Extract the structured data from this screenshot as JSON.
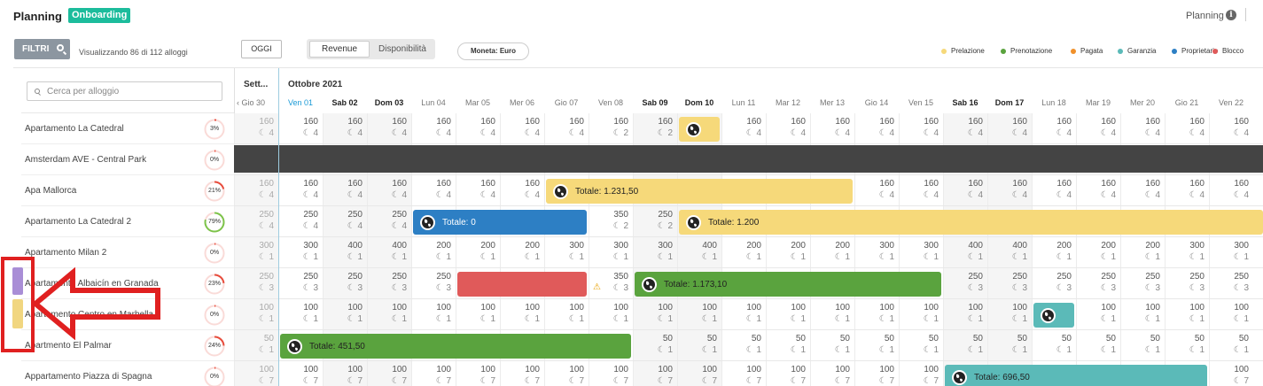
{
  "topbar": {
    "title": "Planning",
    "badge": "Onboarding",
    "right_label": "Planning",
    "info_icon": "info-icon"
  },
  "toolbar": {
    "filter_label": "FILTRI",
    "visualizing_text": "Visualizzando 86 di 112 alloggi",
    "today_label": "OGGI",
    "segments": {
      "revenue": "Revenue",
      "availability": "Disponibilità",
      "active": "Revenue"
    },
    "currency_label": "Moneta: Euro"
  },
  "legend": [
    {
      "label": "Prelazione",
      "color": "#f6d97a"
    },
    {
      "label": "Prenotazione",
      "color": "#5aa33e"
    },
    {
      "label": "Pagata",
      "color": "#f0902a"
    },
    {
      "label": "Garanzia",
      "color": "#5bbab8"
    },
    {
      "label": "Proprietario",
      "color": "#2d7fc4"
    },
    {
      "label": "Blocco",
      "color": "#e05a5a"
    }
  ],
  "search": {
    "placeholder": "Cerca per alloggio"
  },
  "calendar": {
    "week_label": "Sett...",
    "month_label": "Ottobre 2021",
    "prev_day": "Gio 30",
    "days": [
      {
        "label": "Ven 01",
        "weekend": false,
        "today": true
      },
      {
        "label": "Sab 02",
        "weekend": true,
        "today": false
      },
      {
        "label": "Dom 03",
        "weekend": true,
        "today": false
      },
      {
        "label": "Lun 04",
        "weekend": false,
        "today": false
      },
      {
        "label": "Mar 05",
        "weekend": false,
        "today": false
      },
      {
        "label": "Mer 06",
        "weekend": false,
        "today": false
      },
      {
        "label": "Gio 07",
        "weekend": false,
        "today": false
      },
      {
        "label": "Ven 08",
        "weekend": false,
        "today": false
      },
      {
        "label": "Sab 09",
        "weekend": true,
        "today": false
      },
      {
        "label": "Dom 10",
        "weekend": true,
        "today": false
      },
      {
        "label": "Lun 11",
        "weekend": false,
        "today": false
      },
      {
        "label": "Mar 12",
        "weekend": false,
        "today": false
      },
      {
        "label": "Mer 13",
        "weekend": false,
        "today": false
      },
      {
        "label": "Gio 14",
        "weekend": false,
        "today": false
      },
      {
        "label": "Ven 15",
        "weekend": false,
        "today": false
      },
      {
        "label": "Sab 16",
        "weekend": true,
        "today": false
      },
      {
        "label": "Dom 17",
        "weekend": true,
        "today": false
      },
      {
        "label": "Lun 18",
        "weekend": false,
        "today": false
      },
      {
        "label": "Mar 19",
        "weekend": false,
        "today": false
      },
      {
        "label": "Mer 20",
        "weekend": false,
        "today": false
      },
      {
        "label": "Gio 21",
        "weekend": false,
        "today": false
      },
      {
        "label": "Ven 22",
        "weekend": false,
        "today": false
      }
    ]
  },
  "properties": [
    {
      "name": "Apartamento La Catedral",
      "occupancy": "3%",
      "occ_value": 3,
      "ring_color": "#e74c3c",
      "cells": [
        [
          "160",
          "4"
        ],
        [
          "160",
          "4"
        ],
        [
          "160",
          "4"
        ],
        [
          "160",
          "4"
        ],
        [
          "160",
          "4"
        ],
        [
          "160",
          "4"
        ],
        [
          "160",
          "4"
        ],
        [
          "160",
          "4"
        ],
        [
          "160",
          "2"
        ],
        [
          "160",
          "2"
        ],
        null,
        [
          "160",
          "4"
        ],
        [
          "160",
          "4"
        ],
        [
          "160",
          "4"
        ],
        [
          "160",
          "4"
        ],
        [
          "160",
          "4"
        ],
        [
          "160",
          "4"
        ],
        [
          "160",
          "4"
        ],
        [
          "160",
          "4"
        ],
        [
          "160",
          "4"
        ],
        [
          "160",
          "4"
        ],
        [
          "160",
          "4"
        ],
        [
          "160",
          "4"
        ]
      ],
      "bookings": [
        {
          "start": 10,
          "span": 1,
          "label": "",
          "status": "Prelazione"
        }
      ]
    },
    {
      "name": "Amsterdam AVE - Central Park",
      "occupancy": "0%",
      "occ_value": 0,
      "ring_color": "#e74c3c",
      "blocked": true,
      "cells": [],
      "bookings": []
    },
    {
      "name": "Apa Mallorca",
      "occupancy": "21%",
      "occ_value": 21,
      "ring_color": "#e74c3c",
      "cells": [
        [
          "160",
          "4"
        ],
        [
          "160",
          "4"
        ],
        [
          "160",
          "4"
        ],
        [
          "160",
          "4"
        ],
        [
          "160",
          "4"
        ],
        [
          "160",
          "4"
        ],
        [
          "160",
          "4"
        ],
        null,
        null,
        null,
        null,
        null,
        null,
        null,
        [
          "160",
          "4"
        ],
        [
          "160",
          "4"
        ],
        [
          "160",
          "4"
        ],
        [
          "160",
          "4"
        ],
        [
          "160",
          "4"
        ],
        [
          "160",
          "4"
        ],
        [
          "160",
          "4"
        ],
        [
          "160",
          "4"
        ],
        [
          "160",
          "4"
        ]
      ],
      "bookings": [
        {
          "start": 7,
          "span": 7,
          "label": "Totale: 1.231,50",
          "status": "Prelazione"
        }
      ]
    },
    {
      "name": "Apartamento La Catedral 2",
      "occupancy": "79%",
      "occ_value": 79,
      "ring_color": "#7cc44a",
      "cells": [
        [
          "250",
          "4"
        ],
        [
          "250",
          "4"
        ],
        [
          "250",
          "4"
        ],
        [
          "250",
          "4"
        ],
        null,
        null,
        null,
        null,
        [
          "350",
          "2"
        ],
        [
          "250",
          "2"
        ],
        null,
        null,
        null,
        null,
        null,
        null,
        null,
        null,
        null,
        null,
        null,
        null,
        null
      ],
      "bookings": [
        {
          "start": 4,
          "span": 4,
          "label": "Totale: 0",
          "status": "Proprietario"
        },
        {
          "start": 10,
          "span": 14,
          "label": "Totale: 1.200",
          "status": "Prelazione"
        }
      ]
    },
    {
      "name": "Apartamento Milan 2",
      "occupancy": "0%",
      "occ_value": 0,
      "ring_color": "#e74c3c",
      "cells": [
        [
          "300",
          "1"
        ],
        [
          "300",
          "1"
        ],
        [
          "400",
          "1"
        ],
        [
          "400",
          "1"
        ],
        [
          "200",
          "1"
        ],
        [
          "200",
          "1"
        ],
        [
          "200",
          "1"
        ],
        [
          "300",
          "1"
        ],
        [
          "300",
          "1"
        ],
        [
          "300",
          "1"
        ],
        [
          "400",
          "1"
        ],
        [
          "200",
          "1"
        ],
        [
          "200",
          "1"
        ],
        [
          "200",
          "1"
        ],
        [
          "300",
          "1"
        ],
        [
          "300",
          "1"
        ],
        [
          "400",
          "1"
        ],
        [
          "400",
          "1"
        ],
        [
          "200",
          "1"
        ],
        [
          "200",
          "1"
        ],
        [
          "200",
          "1"
        ],
        [
          "300",
          "1"
        ],
        [
          "300",
          "1"
        ]
      ],
      "bookings": []
    },
    {
      "name": "Apartamento Albaicín en Granada",
      "occupancy": "23%",
      "occ_value": 23,
      "ring_color": "#e74c3c",
      "cells": [
        [
          "250",
          "3"
        ],
        [
          "250",
          "3"
        ],
        [
          "250",
          "3"
        ],
        [
          "250",
          "3"
        ],
        [
          "250",
          "3"
        ],
        null,
        null,
        null,
        [
          "350",
          "3"
        ],
        null,
        null,
        null,
        null,
        null,
        null,
        null,
        [
          "250",
          "3"
        ],
        [
          "250",
          "3"
        ],
        [
          "250",
          "3"
        ],
        [
          "250",
          "3"
        ],
        [
          "250",
          "3"
        ],
        [
          "250",
          "3"
        ],
        [
          "250",
          "3"
        ]
      ],
      "bookings": [
        {
          "start": 5,
          "span": 3,
          "label": "",
          "status": "Blocco"
        },
        {
          "start": 9,
          "span": 7,
          "label": "Totale: 1.173,10",
          "status": "Prenotazione"
        }
      ]
    },
    {
      "name": "Apartamento Centro en Marbella",
      "occupancy": "0%",
      "occ_value": 0,
      "ring_color": "#e74c3c",
      "cells": [
        [
          "100",
          "1"
        ],
        [
          "100",
          "1"
        ],
        [
          "100",
          "1"
        ],
        [
          "100",
          "1"
        ],
        [
          "100",
          "1"
        ],
        [
          "100",
          "1"
        ],
        [
          "100",
          "1"
        ],
        [
          "100",
          "1"
        ],
        [
          "100",
          "1"
        ],
        [
          "100",
          "1"
        ],
        [
          "100",
          "1"
        ],
        [
          "100",
          "1"
        ],
        [
          "100",
          "1"
        ],
        [
          "100",
          "1"
        ],
        [
          "100",
          "1"
        ],
        [
          "100",
          "1"
        ],
        [
          "100",
          "1"
        ],
        [
          "100",
          "1"
        ],
        null,
        [
          "100",
          "1"
        ],
        [
          "100",
          "1"
        ],
        [
          "100",
          "1"
        ],
        [
          "100",
          "1"
        ]
      ],
      "bookings": [
        {
          "start": 18,
          "span": 1,
          "label": "",
          "status": "Garanzia"
        }
      ]
    },
    {
      "name": "Apartmento El Palmar",
      "occupancy": "24%",
      "occ_value": 24,
      "ring_color": "#e74c3c",
      "cells": [
        [
          "50",
          "1"
        ],
        null,
        null,
        null,
        null,
        null,
        null,
        null,
        null,
        [
          "50",
          "1"
        ],
        [
          "50",
          "1"
        ],
        [
          "50",
          "1"
        ],
        [
          "50",
          "1"
        ],
        [
          "50",
          "1"
        ],
        [
          "50",
          "1"
        ],
        [
          "50",
          "1"
        ],
        [
          "50",
          "1"
        ],
        [
          "50",
          "1"
        ],
        [
          "50",
          "1"
        ],
        [
          "50",
          "1"
        ],
        [
          "50",
          "1"
        ],
        [
          "50",
          "1"
        ],
        [
          "50",
          "1"
        ]
      ],
      "bookings": [
        {
          "start": 1,
          "span": 8,
          "label": "Totale: 451,50",
          "status": "Prenotazione"
        }
      ]
    },
    {
      "name": "Appartamento Piazza di Spagna",
      "occupancy": "0%",
      "occ_value": 0,
      "ring_color": "#e74c3c",
      "cells": [
        [
          "100",
          "7"
        ],
        [
          "100",
          "7"
        ],
        [
          "100",
          "7"
        ],
        [
          "100",
          "7"
        ],
        [
          "100",
          "7"
        ],
        [
          "100",
          "7"
        ],
        [
          "100",
          "7"
        ],
        [
          "100",
          "7"
        ],
        [
          "100",
          "7"
        ],
        [
          "100",
          "7"
        ],
        [
          "100",
          "7"
        ],
        [
          "100",
          "7"
        ],
        [
          "100",
          "7"
        ],
        [
          "100",
          "7"
        ],
        [
          "100",
          "7"
        ],
        [
          "100",
          "7"
        ],
        null,
        null,
        null,
        null,
        null,
        null,
        [
          "100",
          "7"
        ]
      ],
      "bookings": [
        {
          "start": 16,
          "span": 6,
          "label": "Totale: 696,50",
          "status": "Garanzia"
        }
      ]
    }
  ]
}
